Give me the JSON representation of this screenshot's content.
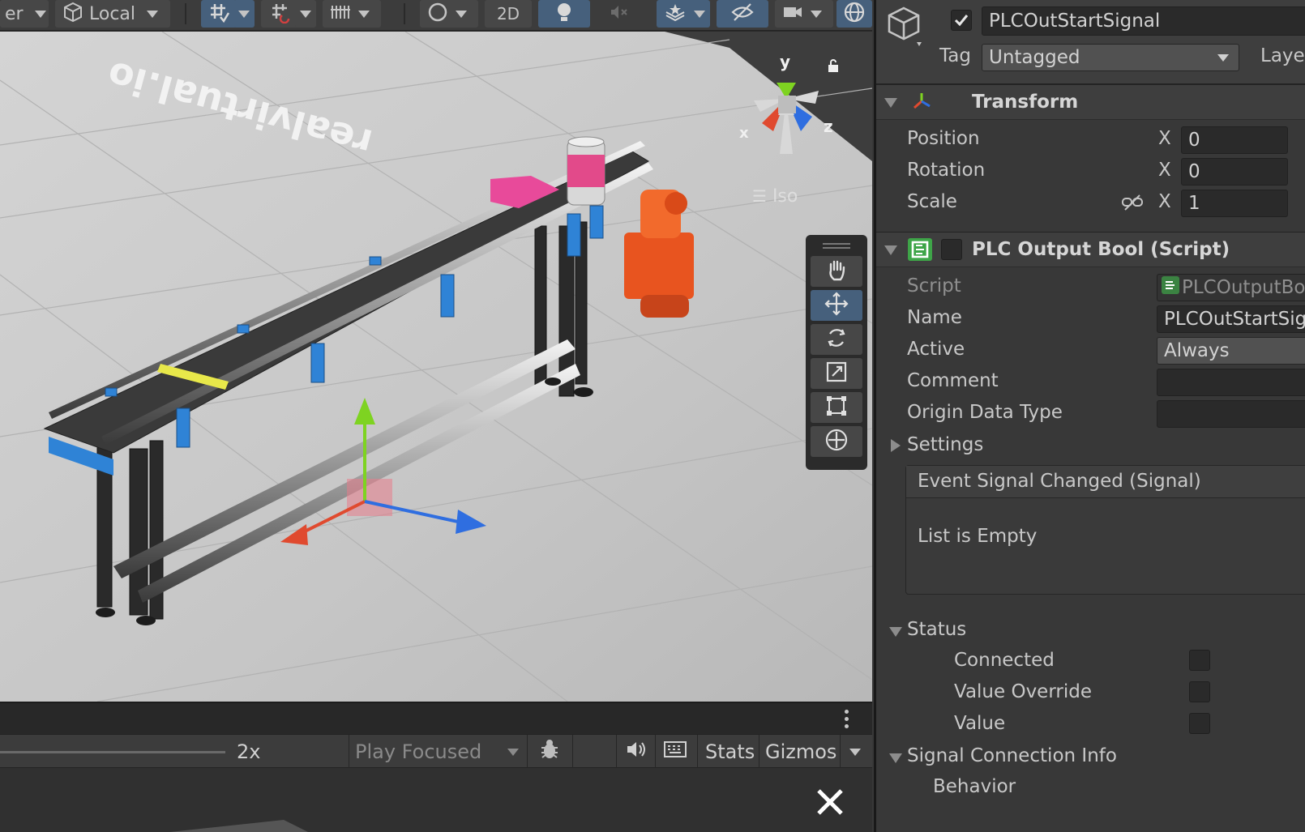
{
  "scene_toolbar": {
    "partial_label": "er",
    "pivot_rotation": "Local",
    "toggle_2d": "2D"
  },
  "scene": {
    "floor_text": "realvirtual.io",
    "gizmo": {
      "y": "y",
      "x": "x",
      "z": "z"
    },
    "projection": "Iso"
  },
  "game_toolbar": {
    "scale_value": "2x",
    "play_mode": "Play Focused",
    "stats": "Stats",
    "gizmos": "Gizmos"
  },
  "inspector": {
    "object_name": "PLCOutStartSignal",
    "tag_label": "Tag",
    "tag_value": "Untagged",
    "layer_label": "Laye",
    "transform": {
      "title": "Transform",
      "rows": [
        {
          "label": "Position",
          "axis": "X",
          "value": "0"
        },
        {
          "label": "Rotation",
          "axis": "X",
          "value": "0"
        },
        {
          "label": "Scale",
          "axis": "X",
          "value": "1"
        }
      ]
    },
    "plc": {
      "title": "PLC Output Bool (Script)",
      "script_label": "Script",
      "script_value": "PLCOutputBo",
      "name_label": "Name",
      "name_value": "PLCOutStartSig",
      "active_label": "Active",
      "active_value": "Always",
      "comment_label": "Comment",
      "comment_value": "",
      "origin_label": "Origin Data Type",
      "origin_value": "",
      "settings_label": "Settings",
      "event_title": "Event Signal Changed (Signal)",
      "event_empty": "List is Empty",
      "status_label": "Status",
      "connected_label": "Connected",
      "override_label": "Value Override",
      "value_label": "Value",
      "connection_info_label": "Signal Connection Info",
      "behavior_label": "Behavior"
    }
  },
  "colors": {
    "accent_blue": "#46607c",
    "conveyor_blue": "#2f83d6",
    "robot_orange": "#e8541f",
    "gizmo_y": "#7ed321",
    "gizmo_x": "#e04a2f",
    "gizmo_z": "#2f6ee0"
  }
}
